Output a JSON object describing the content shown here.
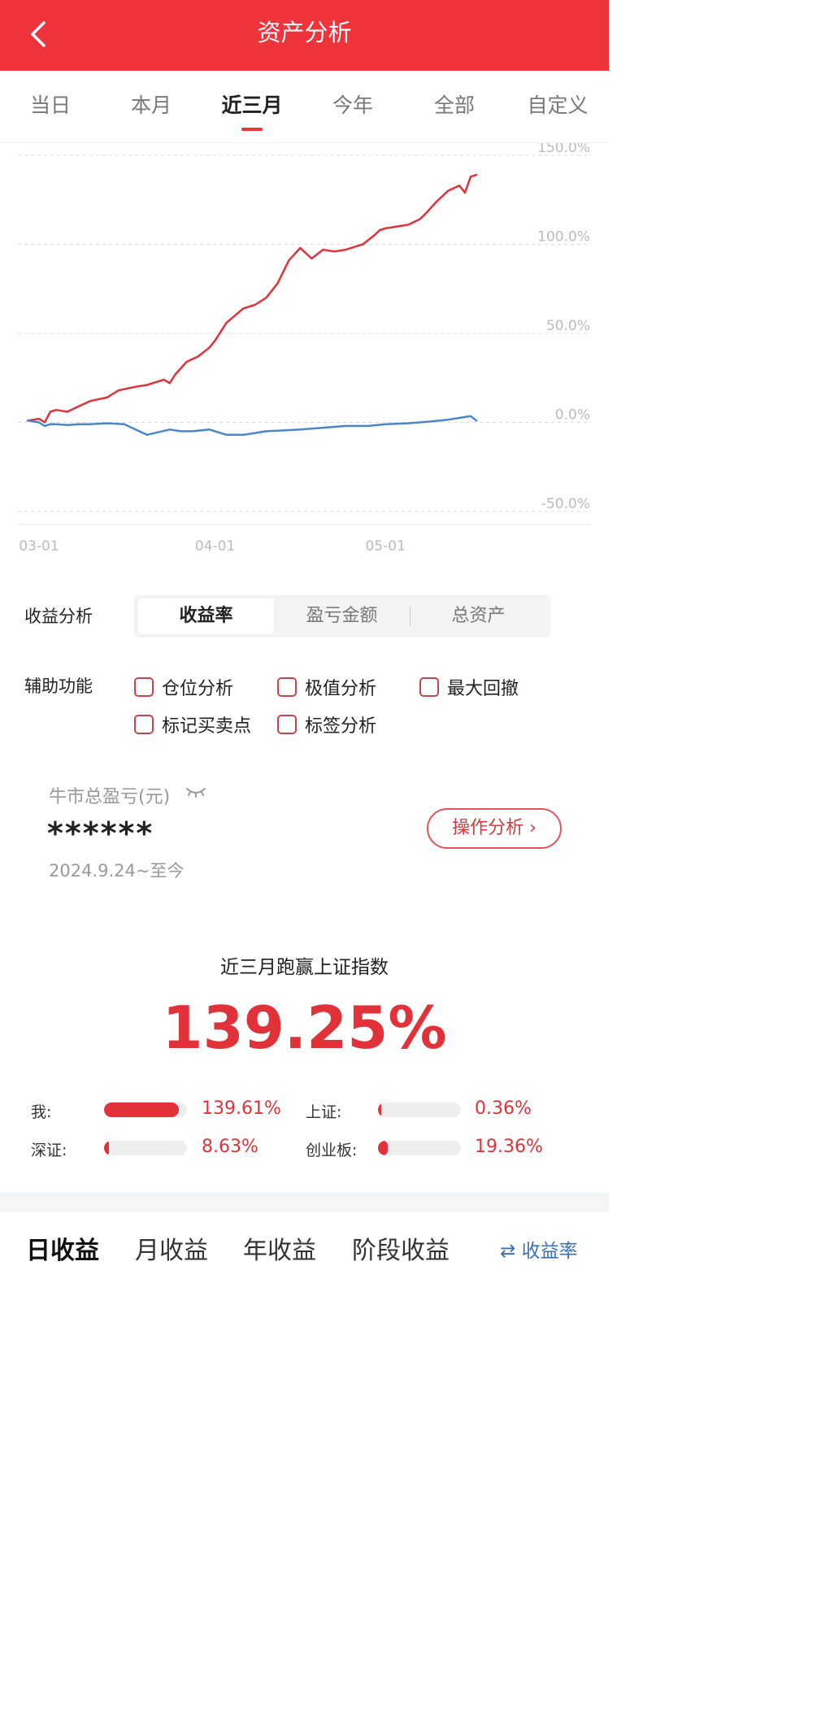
{
  "header": {
    "title": "资产分析"
  },
  "tabs": [
    "当日",
    "本月",
    "近三月",
    "今年",
    "全部",
    "自定义"
  ],
  "active_tab_index": 2,
  "chart_data": {
    "type": "line",
    "y_ticks": [
      "150.0%",
      "100.0%",
      "50.0%",
      "0.0%",
      "-50.0%"
    ],
    "x_ticks": [
      "03-01",
      "04-01",
      "05-01"
    ],
    "ylim": [
      -50,
      150
    ],
    "grid": true,
    "colors": {
      "mine": "#e1323a",
      "index": "#4a86c8"
    },
    "series": [
      {
        "key": "mine",
        "x": [
          "02-27",
          "02-28",
          "03-01",
          "03-02",
          "03-03",
          "03-04",
          "03-05",
          "03-06",
          "03-08",
          "03-10",
          "03-13",
          "03-15",
          "03-18",
          "03-20",
          "03-23",
          "03-24",
          "03-25",
          "03-27",
          "03-29",
          "03-31",
          "04-01",
          "04-03",
          "04-06",
          "04-08",
          "04-10",
          "04-12",
          "04-14",
          "04-16",
          "04-18",
          "04-20",
          "04-22",
          "04-24",
          "04-26",
          "04-27",
          "04-29",
          "04-30",
          "05-01",
          "05-03",
          "05-05",
          "05-07",
          "05-08",
          "05-10",
          "05-12",
          "05-14",
          "05-15",
          "05-16",
          "05-17"
        ],
        "values": [
          1,
          1.5,
          2,
          0,
          6,
          7,
          6.5,
          6,
          9,
          12,
          14,
          18,
          20,
          21,
          24,
          22,
          27,
          34,
          37,
          42,
          46,
          56,
          64,
          66,
          70,
          78,
          91,
          98,
          92,
          97,
          96,
          97,
          99,
          100,
          105,
          108,
          109,
          110,
          111,
          114,
          117,
          124,
          130,
          133,
          129,
          138,
          139
        ]
      },
      {
        "key": "index",
        "x": [
          "02-27",
          "02-28",
          "03-01",
          "03-02",
          "03-03",
          "03-04",
          "03-06",
          "03-08",
          "03-10",
          "03-13",
          "03-16",
          "03-20",
          "03-24",
          "03-26",
          "03-28",
          "03-31",
          "04-01",
          "04-03",
          "04-06",
          "04-08",
          "04-10",
          "04-13",
          "04-16",
          "04-20",
          "04-24",
          "04-28",
          "05-01",
          "05-05",
          "05-09",
          "05-12",
          "05-14",
          "05-15",
          "05-16",
          "05-17"
        ],
        "values": [
          1,
          0.5,
          0,
          -2,
          -1,
          -1,
          -1.5,
          -1,
          -1,
          -0.5,
          -1,
          -7,
          -4,
          -5,
          -5,
          -4,
          -5,
          -7,
          -7,
          -6,
          -5,
          -4.5,
          -4,
          -3,
          -2,
          -2,
          -1,
          -0.5,
          0.5,
          1.5,
          2.5,
          3,
          3.5,
          1
        ]
      }
    ]
  },
  "analysis": {
    "label": "收益分析",
    "segments": [
      "收益率",
      "盈亏金额",
      "总资产"
    ],
    "active_segment": 0
  },
  "aux": {
    "label": "辅助功能",
    "options": [
      "仓位分析",
      "极值分析",
      "最大回撤",
      "标记买卖点",
      "标签分析"
    ]
  },
  "bull": {
    "label": "牛市总盈亏(元)",
    "value": "******",
    "since": "2024.9.24~至今",
    "button": "操作分析 ›"
  },
  "beat": {
    "title": "近三月跑赢上证指数",
    "value": "139.25%"
  },
  "compare": [
    {
      "label": "我:",
      "value": "139.61%",
      "fill": 0.9
    },
    {
      "label": "上证:",
      "value": "0.36%",
      "fill": 0.02
    },
    {
      "label": "深证:",
      "value": "8.63%",
      "fill": 0.06
    },
    {
      "label": "创业板:",
      "value": "19.36%",
      "fill": 0.12
    }
  ],
  "bottom_tabs": [
    "日收益",
    "月收益",
    "年收益",
    "阶段收益"
  ],
  "bottom_right": "⇄ 收益率"
}
